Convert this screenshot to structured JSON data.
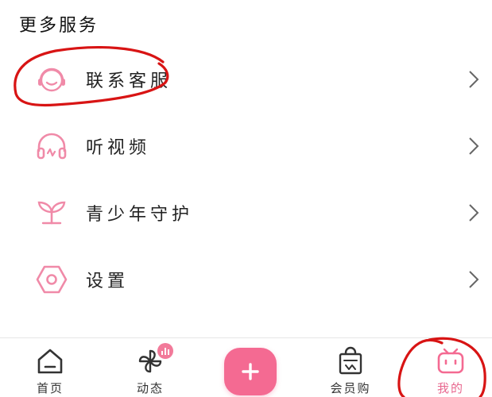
{
  "section_title": "更多服务",
  "menu": [
    {
      "label": "联系客服",
      "icon": "headset-icon"
    },
    {
      "label": "听视频",
      "icon": "headphones-icon"
    },
    {
      "label": "青少年守护",
      "icon": "sprout-icon"
    },
    {
      "label": "设置",
      "icon": "gear-icon"
    }
  ],
  "tabbar": {
    "home": "首页",
    "dynamic": "动态",
    "member_shop": "会员购",
    "mine": "我的"
  },
  "colors": {
    "accent": "#f46a92",
    "icon_pink": "#f08aa8",
    "annotation_red": "#d81414"
  }
}
